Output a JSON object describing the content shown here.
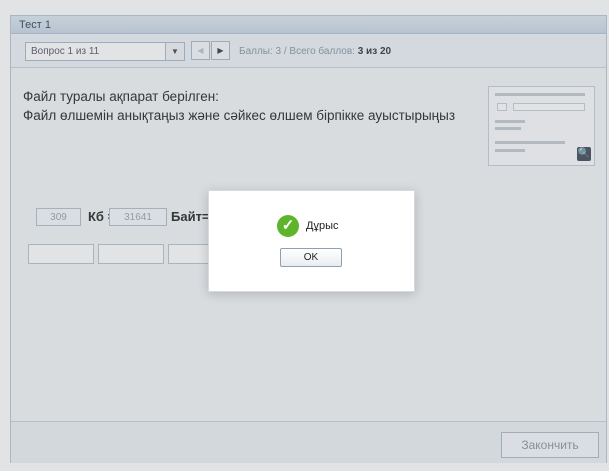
{
  "window": {
    "title": "Тест 1"
  },
  "toolbar": {
    "question_select": "Вопрос 1 из 11",
    "score_label": "Баллы: 3 / Всего баллов:",
    "score_value": "3 из 20",
    "prev_icon": "triangle-left",
    "next_icon": "triangle-right"
  },
  "question": {
    "line1": "Файл туралы ақпарат берілген:",
    "line2": "Файл өлшемін анықтаңыз және сәйкес өлшем бірпікке ауыстырыңыз"
  },
  "answer": {
    "value1": "309",
    "unit1": "Кб =",
    "value2": "31641",
    "unit2": "Байт="
  },
  "dialog": {
    "message": "Дұрыс",
    "ok_label": "OK",
    "icon": "check-circle-icon",
    "icon_color": "#5eb52b"
  },
  "footer": {
    "finish_label": "Закончить"
  }
}
